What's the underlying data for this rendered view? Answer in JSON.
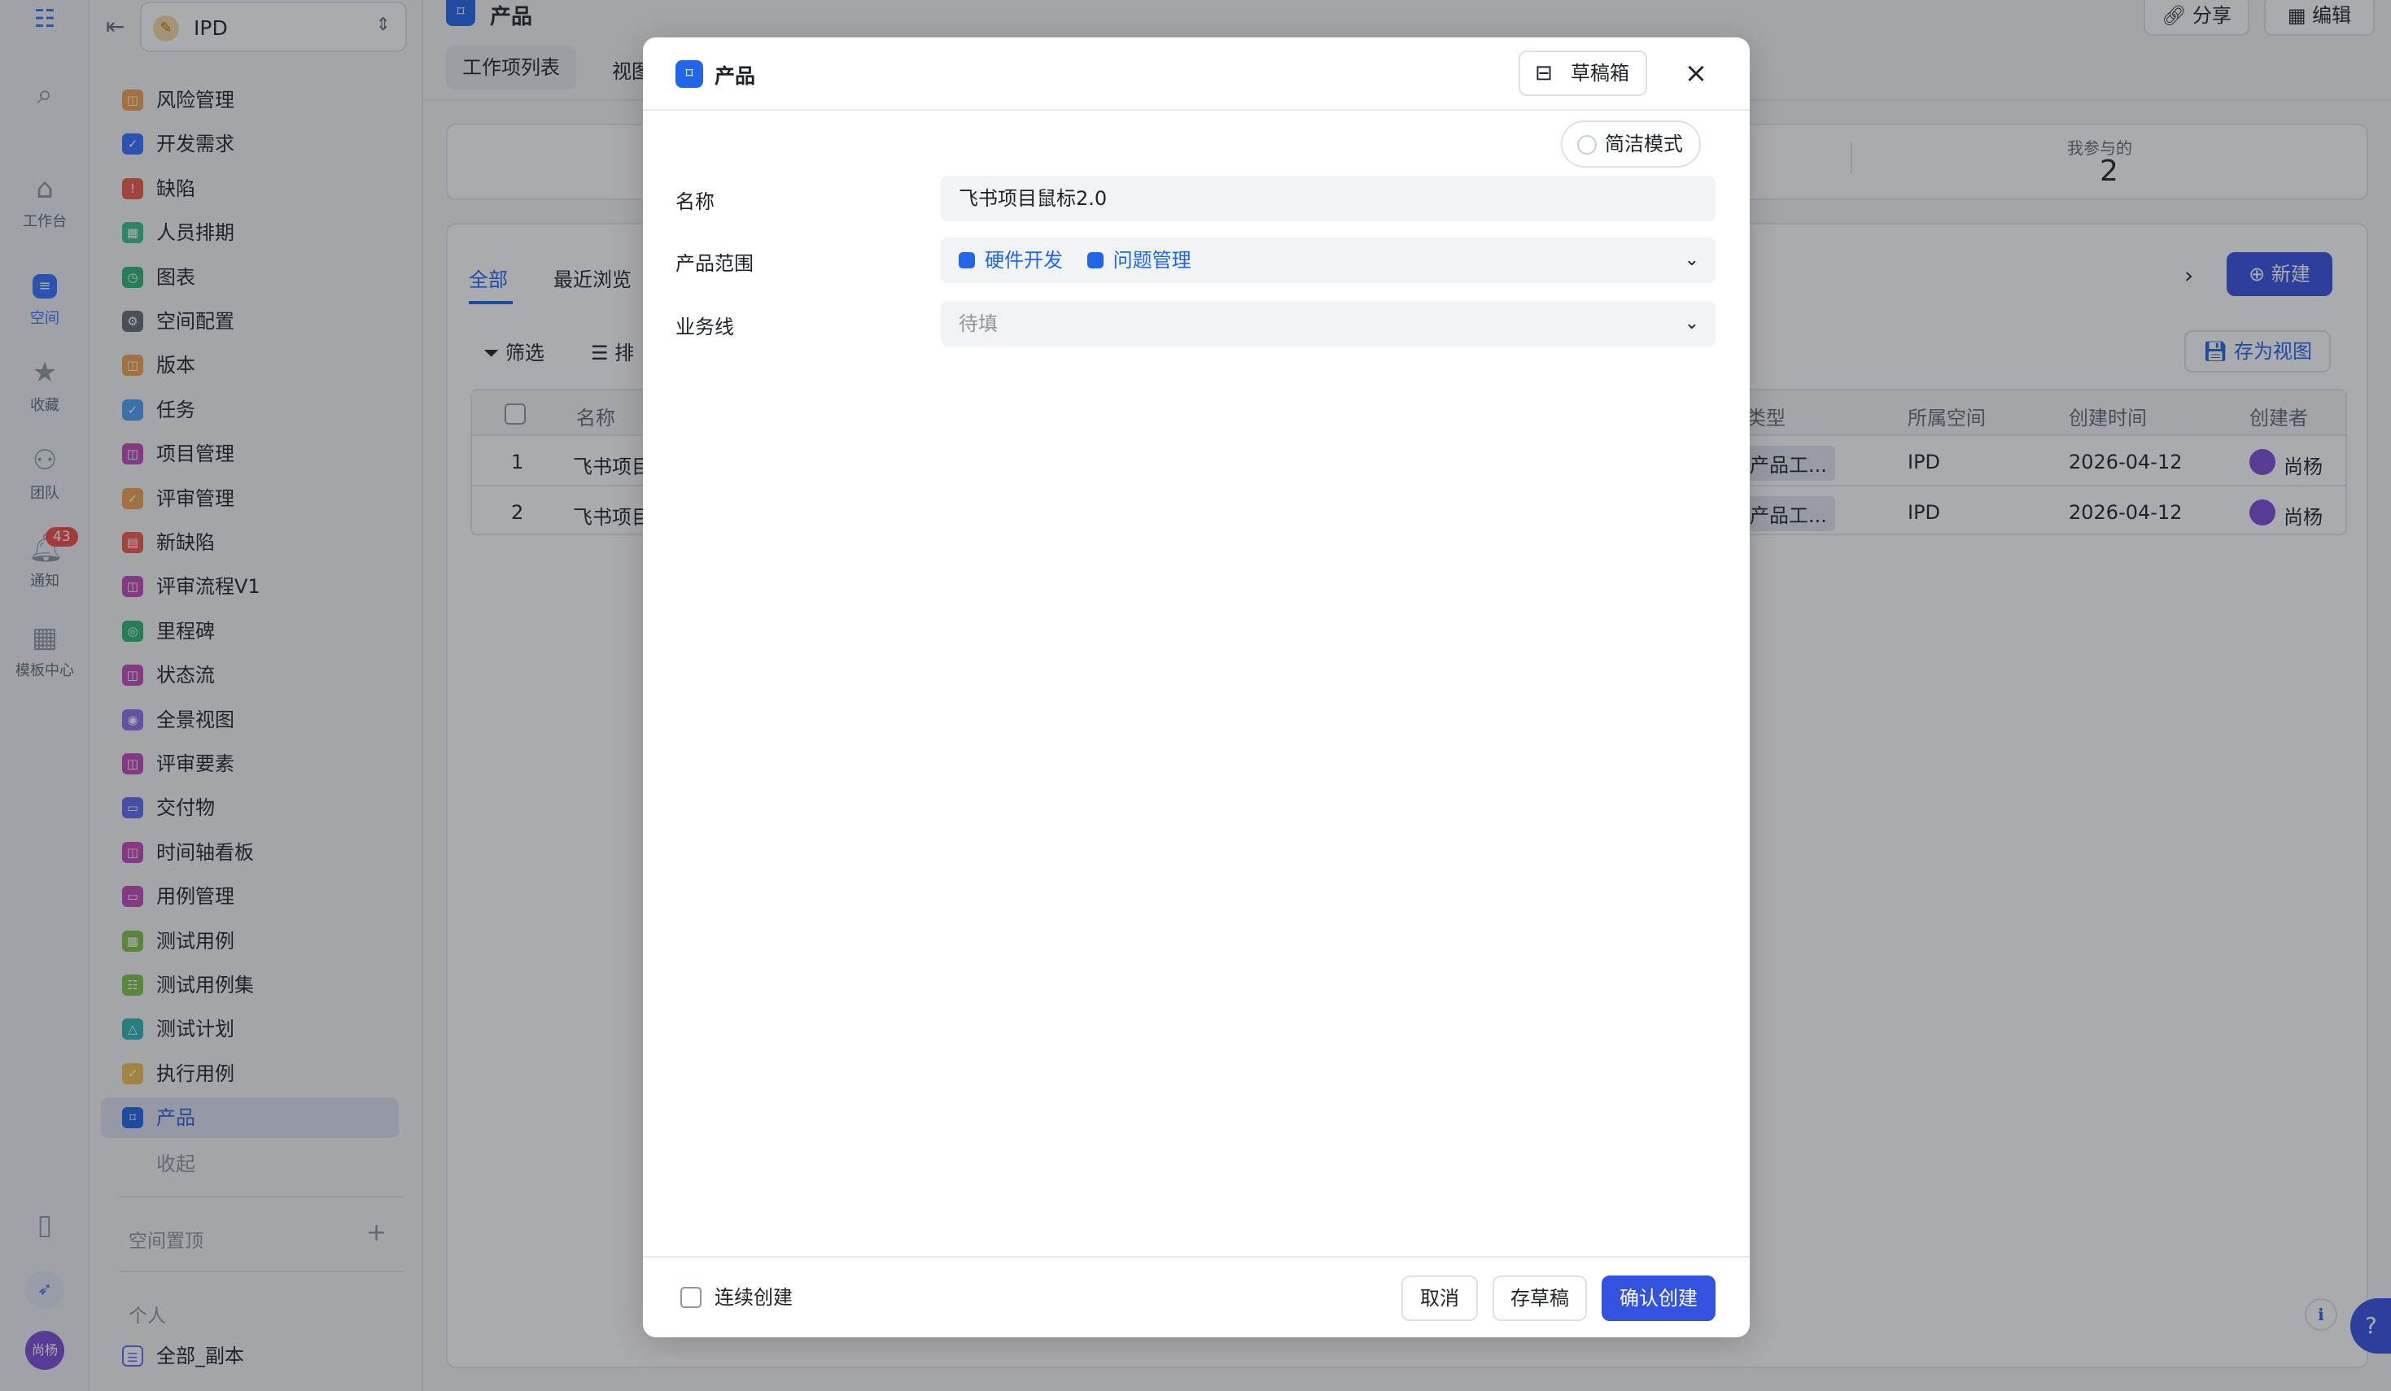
{
  "rail": {
    "items": [
      {
        "label": "工作台"
      },
      {
        "label": "空间"
      },
      {
        "label": "收藏"
      },
      {
        "label": "团队"
      },
      {
        "label": "通知",
        "badge": "43"
      },
      {
        "label": "模板中心"
      }
    ],
    "user": "尚杨"
  },
  "sidebar": {
    "space_name": "IPD",
    "items": [
      {
        "label": "风险管理",
        "color": "#f0a34d"
      },
      {
        "label": "开发需求",
        "color": "#3370ff"
      },
      {
        "label": "缺陷",
        "color": "#f05a4b"
      },
      {
        "label": "人员排期",
        "color": "#34c38f"
      },
      {
        "label": "图表",
        "color": "#2bb673"
      },
      {
        "label": "空间配置",
        "color": "#646a73"
      },
      {
        "label": "版本",
        "color": "#f0a34d"
      },
      {
        "label": "任务",
        "color": "#4ea0f5"
      },
      {
        "label": "项目管理",
        "color": "#c04ab8"
      },
      {
        "label": "评审管理",
        "color": "#f0a34d"
      },
      {
        "label": "新缺陷",
        "color": "#f05a4b"
      },
      {
        "label": "评审流程V1",
        "color": "#c04ab8"
      },
      {
        "label": "里程碑",
        "color": "#2bb673"
      },
      {
        "label": "状态流",
        "color": "#c04ab8"
      },
      {
        "label": "全景视图",
        "color": "#8e6cf0"
      },
      {
        "label": "评审要素",
        "color": "#c04ab8"
      },
      {
        "label": "交付物",
        "color": "#5b6bf0"
      },
      {
        "label": "时间轴看板",
        "color": "#c04ab8"
      },
      {
        "label": "用例管理",
        "color": "#c04ab8"
      },
      {
        "label": "测试用例",
        "color": "#7cc34a"
      },
      {
        "label": "测试用例集",
        "color": "#7cc34a"
      },
      {
        "label": "测试计划",
        "color": "#2bb6b6"
      },
      {
        "label": "执行用例",
        "color": "#f0c04d"
      },
      {
        "label": "产品",
        "color": "#1f66e8"
      }
    ],
    "collapse": "收起",
    "pinned": "空间置顶",
    "personal": "个人",
    "personal_item": "全部_副本"
  },
  "background": {
    "page_title": "产品",
    "tab_list": "工作项列表",
    "tab_view": "视图",
    "share": "分享",
    "edit": "编辑",
    "stat_label": "我参与的",
    "stat_value": "2",
    "filter_all": "全部",
    "filter_recent": "最近浏览",
    "new_button": "新建",
    "filter_button": "筛选",
    "sort_button": "排",
    "save_view": "存为视图",
    "columns": [
      "名称",
      "类型",
      "所属空间",
      "创建时间",
      "创建者"
    ],
    "rows": [
      {
        "index": "1",
        "name": "飞书项目",
        "type": "产品工...",
        "space": "IPD",
        "created": "2026-04-12",
        "creator": "尚杨"
      },
      {
        "index": "2",
        "name": "飞书项目",
        "type": "产品工...",
        "space": "IPD",
        "created": "2026-04-12",
        "creator": "尚杨"
      }
    ]
  },
  "modal": {
    "title": "产品",
    "drafts": "草稿箱",
    "simple_mode": "简洁模式",
    "fields": {
      "name_label": "名称",
      "name_value": "飞书项目鼠标2.0",
      "scope_label": "产品范围",
      "scope_tags": [
        "硬件开发",
        "问题管理"
      ],
      "line_label": "业务线",
      "line_placeholder": "待填"
    },
    "footer": {
      "continuous": "连续创建",
      "cancel": "取消",
      "save_draft": "存草稿",
      "confirm": "确认创建"
    }
  }
}
